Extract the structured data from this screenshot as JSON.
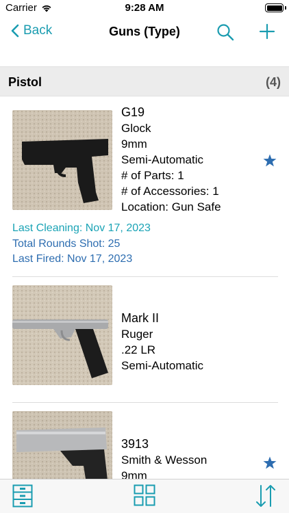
{
  "status_bar": {
    "carrier": "Carrier",
    "time": "9:28 AM"
  },
  "nav": {
    "back_label": "Back",
    "title": "Guns (Type)"
  },
  "section": {
    "title": "Pistol",
    "count": "(4)"
  },
  "items": [
    {
      "model": "G19",
      "maker": "Glock",
      "caliber": "9mm",
      "action": "Semi-Automatic",
      "parts": "# of Parts: 1",
      "accessories": "# of Accessories: 1",
      "location": "Location: Gun Safe",
      "favorite": true,
      "last_cleaning": "Last Cleaning: Nov 17, 2023",
      "rounds": "Total Rounds Shot: 25",
      "last_fired": "Last Fired: Nov 17, 2023"
    },
    {
      "model": "Mark II",
      "maker": "Ruger",
      "caliber": ".22 LR",
      "action": "Semi-Automatic",
      "favorite": false
    },
    {
      "model": "3913",
      "maker": "Smith & Wesson",
      "caliber": "9mm",
      "favorite": true
    }
  ],
  "icons": {
    "back": "chevron-left-icon",
    "search": "search-icon",
    "add": "plus-icon",
    "favorite": "star-icon",
    "tab_list": "file-cabinet-icon",
    "tab_grid": "grid-icon",
    "tab_sort": "sort-icon"
  },
  "colors": {
    "accent": "#1a9cb0",
    "star": "#2d6db0",
    "stat_teal": "#1aa3b5",
    "stat_blue": "#2d6db0"
  }
}
